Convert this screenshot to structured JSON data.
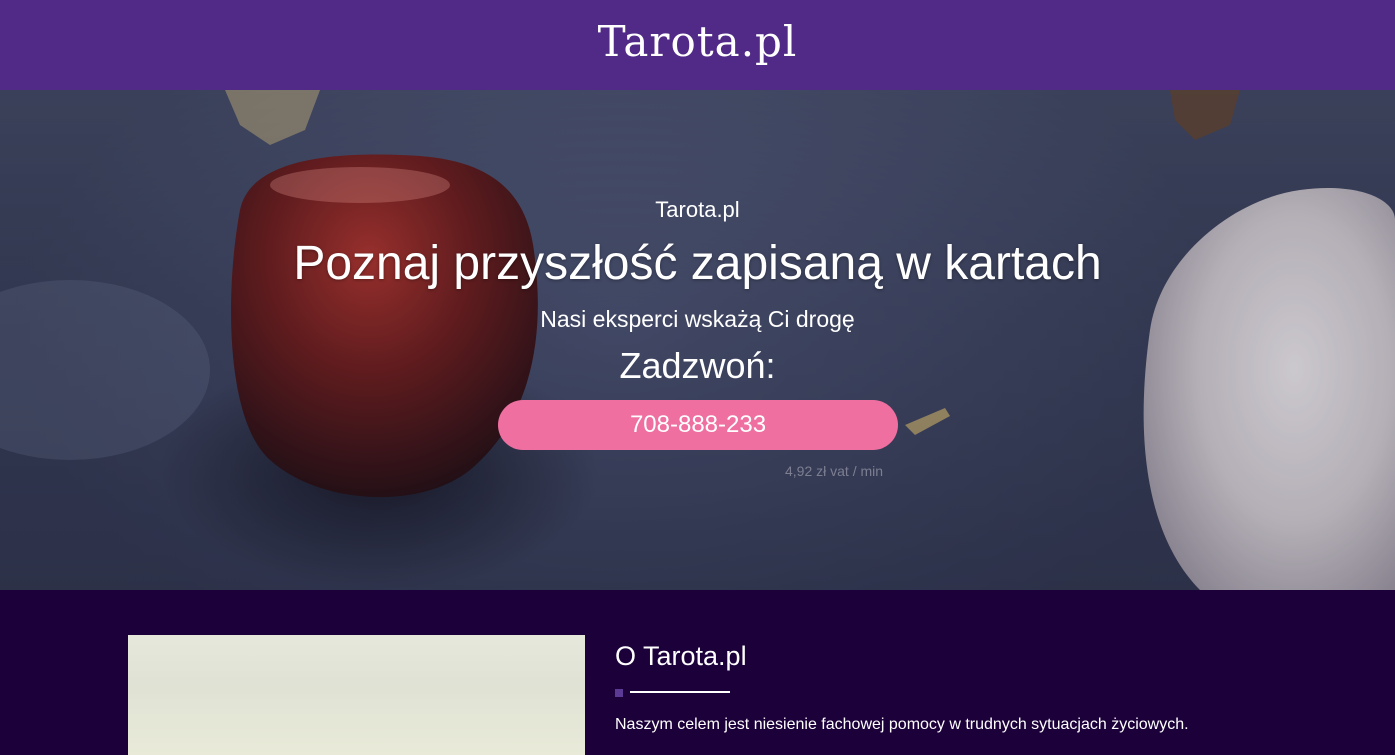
{
  "header": {
    "logo": "Tarota.pl"
  },
  "hero": {
    "kicker": "Tarota.pl",
    "title": "Poznaj przyszłość zapisaną w kartach",
    "subtitle": "Nasi eksperci wskażą Ci drogę",
    "call_label": "Zadzwoń:",
    "phone": "708-888-233",
    "price_note": "4,92 zł vat / min"
  },
  "about": {
    "title": "O Tarota.pl",
    "text": "Naszym celem jest niesienie fachowej pomocy w trudnych sytuacjach życiowych."
  },
  "colors": {
    "header_bg": "#502a86",
    "section_bg": "#1b003a",
    "button": "#ee6fa0",
    "accent": "#5b3a96"
  }
}
